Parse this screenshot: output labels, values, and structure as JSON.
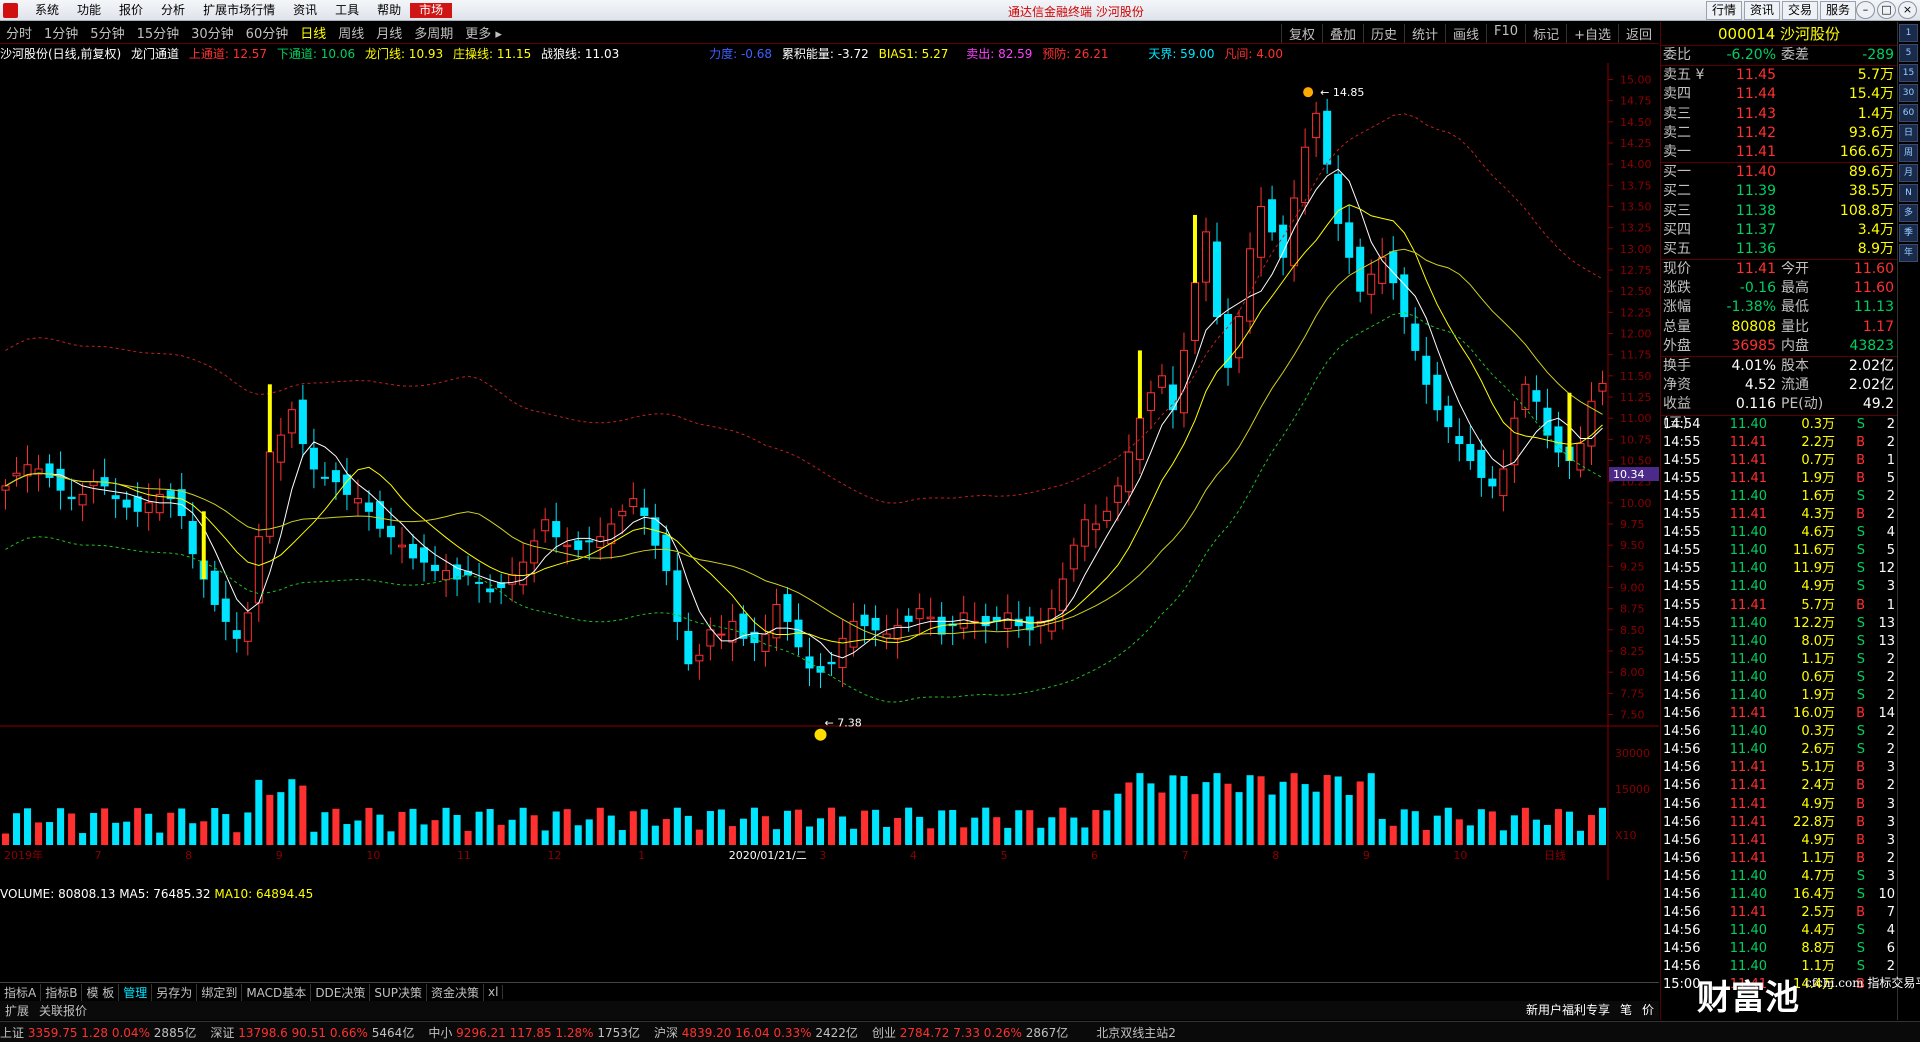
{
  "titlebar": {
    "menu": [
      "系统",
      "功能",
      "报价",
      "分析",
      "扩展市场行情",
      "资讯",
      "工具",
      "帮助",
      "市场"
    ],
    "center_title": "通达信金融终端  沙河股份",
    "right_buttons": [
      "行情",
      "资讯",
      "交易",
      "服务"
    ]
  },
  "periods": [
    "分时",
    "1分钟",
    "5分钟",
    "15分钟",
    "30分钟",
    "60分钟",
    "日线",
    "周线",
    "月线",
    "多周期",
    "更多 ▸"
  ],
  "selected_period": "日线",
  "toolbar_right": [
    "复权",
    "叠加",
    "历史",
    "统计",
    "画线",
    "F10",
    "标记",
    "+自选",
    "返回"
  ],
  "indicators": {
    "stock_label": "沙河股份(日线,前复权)",
    "indicator_name": "龙门通道",
    "upper_channel": "上通道: 12.57",
    "lower_channel": "下通道: 10.06",
    "dragon_gate": "龙门线: 10.93",
    "banker_line": "庄操线: 11.15",
    "war_line": "战狼线: 11.03",
    "force": "力度: -0.68",
    "energy": "累积能量: -3.72",
    "bias": "BIAS1: 5.27",
    "sell": "卖出: 82.59",
    "warn": "预防: 26.21",
    "sky": "天界: 59.00",
    "dragon": "凡间: 4.00"
  },
  "price_axis": [
    "15.00",
    "14.75",
    "14.50",
    "14.25",
    "14.00",
    "13.75",
    "13.50",
    "13.25",
    "13.00",
    "12.75",
    "12.50",
    "12.25",
    "12.00",
    "11.75",
    "11.50",
    "11.25",
    "11.00",
    "10.75",
    "10.50",
    "10.25",
    "10.00",
    "9.75",
    "9.50",
    "9.25",
    "9.00",
    "8.75",
    "8.50",
    "8.25",
    "8.00",
    "7.75",
    "7.50"
  ],
  "price_tag": "10.34",
  "high_label": "14.85",
  "low_label": "7.38",
  "month_labels": [
    "2019年",
    "7",
    "8",
    "9",
    "10",
    "11",
    "12",
    "1",
    "2020/01/21/二",
    "3",
    "4",
    "5",
    "6",
    "7",
    "8",
    "9",
    "10",
    "日线"
  ],
  "volume": {
    "label": "VOLUME: 80808.13",
    "ma5": "MA5: 76485.32",
    "ma10": "MA10: 64894.45",
    "axis": [
      "30000",
      "15000",
      "X10"
    ]
  },
  "bottom_tabs": [
    "指标A",
    "指标B",
    "模 板",
    "管理",
    "另存为",
    "绑定到",
    "MACD基本",
    "DDE决策",
    "SUP决策",
    "资金决策",
    "xl"
  ],
  "selected_tab": "管理",
  "ext_bar": [
    "扩展",
    "关联报价"
  ],
  "news_bar": [
    "新用户福利专享",
    "笔",
    "价"
  ],
  "index_bar": [
    {
      "name": "上证",
      "val": "3359.75",
      "chg": "1.28",
      "pct": "0.04%",
      "amt": "2885亿"
    },
    {
      "name": "深证",
      "val": "13798.6",
      "chg": "90.51",
      "pct": "0.66%",
      "amt": "5464亿"
    },
    {
      "name": "中小",
      "val": "9296.21",
      "chg": "117.85",
      "pct": "1.28%",
      "amt": "1753亿"
    },
    {
      "name": "沪深",
      "val": "4839.20",
      "chg": "16.04",
      "pct": "0.33%",
      "amt": "2422亿"
    },
    {
      "name": "创业",
      "val": "2784.72",
      "chg": "7.33",
      "pct": "0.26%",
      "amt": "2867亿"
    }
  ],
  "station": "北京双线主站2",
  "quote": {
    "header": "000014 沙河股份",
    "weibi_label": "委比",
    "weibi": "-6.20%",
    "weicha_label": "委差",
    "weicha": "-289",
    "sell": [
      {
        "label": "卖五 ¥",
        "price": "11.45",
        "vol": "5.7万"
      },
      {
        "label": "卖四",
        "price": "11.44",
        "vol": "15.4万"
      },
      {
        "label": "卖三",
        "price": "11.43",
        "vol": "1.4万"
      },
      {
        "label": "卖二",
        "price": "11.42",
        "vol": "93.6万"
      },
      {
        "label": "卖一",
        "price": "11.41",
        "vol": "166.6万"
      }
    ],
    "buy": [
      {
        "label": "买一",
        "price": "11.40",
        "vol": "89.6万"
      },
      {
        "label": "买二",
        "price": "11.39",
        "vol": "38.5万"
      },
      {
        "label": "买三",
        "price": "11.38",
        "vol": "108.8万"
      },
      {
        "label": "买四",
        "price": "11.37",
        "vol": "3.4万"
      },
      {
        "label": "买五",
        "price": "11.36",
        "vol": "8.9万"
      }
    ],
    "stats": [
      {
        "l1": "现价",
        "v1": "11.41",
        "l2": "今开",
        "v2": "11.60",
        "c1": "red",
        "c2": "red"
      },
      {
        "l1": "涨跌",
        "v1": "-0.16",
        "l2": "最高",
        "v2": "11.60",
        "c1": "green",
        "c2": "red"
      },
      {
        "l1": "涨幅",
        "v1": "-1.38%",
        "l2": "最低",
        "v2": "11.13",
        "c1": "green",
        "c2": "green"
      },
      {
        "l1": "总量",
        "v1": "80808",
        "l2": "量比",
        "v2": "1.17",
        "c1": "yellow",
        "c2": "red"
      },
      {
        "l1": "外盘",
        "v1": "36985",
        "l2": "内盘",
        "v2": "43823",
        "c1": "red",
        "c2": "green"
      }
    ],
    "stats2": [
      {
        "l1": "换手",
        "v1": "4.01%",
        "l2": "股本",
        "v2": "2.02亿"
      },
      {
        "l1": "净资",
        "v1": "4.52",
        "l2": "流通",
        "v2": "2.02亿"
      },
      {
        "l1": "收益(三)",
        "v1": "0.116",
        "l2": "PE(动)",
        "v2": "49.2"
      }
    ]
  },
  "ticks": [
    [
      "14:54",
      "11.40",
      "0.3万",
      "S",
      "2"
    ],
    [
      "14:55",
      "11.41",
      "2.2万",
      "B",
      "2"
    ],
    [
      "14:55",
      "11.41",
      "0.7万",
      "B",
      "1"
    ],
    [
      "14:55",
      "11.41",
      "1.9万",
      "B",
      "5"
    ],
    [
      "14:55",
      "11.40",
      "1.6万",
      "S",
      "2"
    ],
    [
      "14:55",
      "11.41",
      "4.3万",
      "B",
      "2"
    ],
    [
      "14:55",
      "11.40",
      "4.6万",
      "S",
      "4"
    ],
    [
      "14:55",
      "11.40",
      "11.6万",
      "S",
      "5"
    ],
    [
      "14:55",
      "11.40",
      "11.9万",
      "S",
      "12"
    ],
    [
      "14:55",
      "11.40",
      "4.9万",
      "S",
      "3"
    ],
    [
      "14:55",
      "11.41",
      "5.7万",
      "B",
      "1"
    ],
    [
      "14:55",
      "11.40",
      "12.2万",
      "S",
      "13"
    ],
    [
      "14:55",
      "11.40",
      "8.0万",
      "S",
      "13"
    ],
    [
      "14:55",
      "11.40",
      "1.1万",
      "S",
      "2"
    ],
    [
      "14:56",
      "11.40",
      "0.6万",
      "S",
      "2"
    ],
    [
      "14:56",
      "11.40",
      "1.9万",
      "S",
      "2"
    ],
    [
      "14:56",
      "11.41",
      "16.0万",
      "B",
      "14"
    ],
    [
      "14:56",
      "11.40",
      "0.3万",
      "S",
      "2"
    ],
    [
      "14:56",
      "11.40",
      "2.6万",
      "S",
      "2"
    ],
    [
      "14:56",
      "11.41",
      "5.1万",
      "B",
      "3"
    ],
    [
      "14:56",
      "11.41",
      "2.4万",
      "B",
      "2"
    ],
    [
      "14:56",
      "11.41",
      "4.9万",
      "B",
      "3"
    ],
    [
      "14:56",
      "11.41",
      "22.8万",
      "B",
      "3"
    ],
    [
      "14:56",
      "11.41",
      "4.9万",
      "B",
      "3"
    ],
    [
      "14:56",
      "11.41",
      "1.1万",
      "B",
      "2"
    ],
    [
      "14:56",
      "11.40",
      "4.7万",
      "S",
      "3"
    ],
    [
      "14:56",
      "11.40",
      "16.4万",
      "S",
      "10"
    ],
    [
      "14:56",
      "11.41",
      "2.5万",
      "B",
      "7"
    ],
    [
      "14:56",
      "11.40",
      "4.4万",
      "S",
      "4"
    ],
    [
      "14:56",
      "11.40",
      "8.8万",
      "S",
      "6"
    ],
    [
      "14:56",
      "11.40",
      "1.1万",
      "S",
      "2"
    ],
    [
      "15:00",
      "11.41",
      "14.4万",
      "B",
      ""
    ]
  ],
  "right_strip": [
    "1",
    "5",
    "15",
    "30",
    "60",
    "日",
    "周",
    "月",
    "N",
    "多",
    "季",
    "年"
  ],
  "watermark": "财富池",
  "watermark_sub": "cfchi.com 指标交易平台",
  "chart_data": {
    "type": "candlestick",
    "closes": [
      10.2,
      10.35,
      10.45,
      10.4,
      10.3,
      10.15,
      10.05,
      10.1,
      10.25,
      10.2,
      10.05,
      9.95,
      9.9,
      10.0,
      10.1,
      10.05,
      9.85,
      9.4,
      9.1,
      8.8,
      8.6,
      8.4,
      8.7,
      9.6,
      10.6,
      10.8,
      11.1,
      10.7,
      10.4,
      10.3,
      10.25,
      10.1,
      10.05,
      9.9,
      9.7,
      9.6,
      9.5,
      9.35,
      9.3,
      9.2,
      9.2,
      9.1,
      9.15,
      9.05,
      8.95,
      9.0,
      9.15,
      9.3,
      9.55,
      9.8,
      9.6,
      9.5,
      9.45,
      9.55,
      9.6,
      9.75,
      9.9,
      10.05,
      9.85,
      9.5,
      9.2,
      8.6,
      8.1,
      8.2,
      8.5,
      8.45,
      8.6,
      8.4,
      8.35,
      8.45,
      8.8,
      8.6,
      8.3,
      8.05,
      8.0,
      8.1,
      8.4,
      8.6,
      8.55,
      8.5,
      8.45,
      8.55,
      8.6,
      8.75,
      8.65,
      8.45,
      8.55,
      8.7,
      8.6,
      8.55,
      8.6,
      8.7,
      8.55,
      8.5,
      8.6,
      8.75,
      9.1,
      9.5,
      9.8,
      9.75,
      9.9,
      10.2,
      10.6,
      11.0,
      11.3,
      11.5,
      11.1,
      11.8,
      12.6,
      13.2,
      12.2,
      11.6,
      12.2,
      13.0,
      13.5,
      13.2,
      12.9,
      13.6,
      14.2,
      14.6,
      14.0,
      13.3,
      12.9,
      12.5,
      12.7,
      12.9,
      12.6,
      12.2,
      11.8,
      11.4,
      11.1,
      10.9,
      10.7,
      10.5,
      10.3,
      10.2,
      10.4,
      11.0,
      11.4,
      11.2,
      10.8,
      10.6,
      10.5,
      10.7,
      11.2,
      11.41
    ],
    "ylim": [
      7.4,
      15.1
    ],
    "high": 14.85,
    "low": 7.38
  }
}
